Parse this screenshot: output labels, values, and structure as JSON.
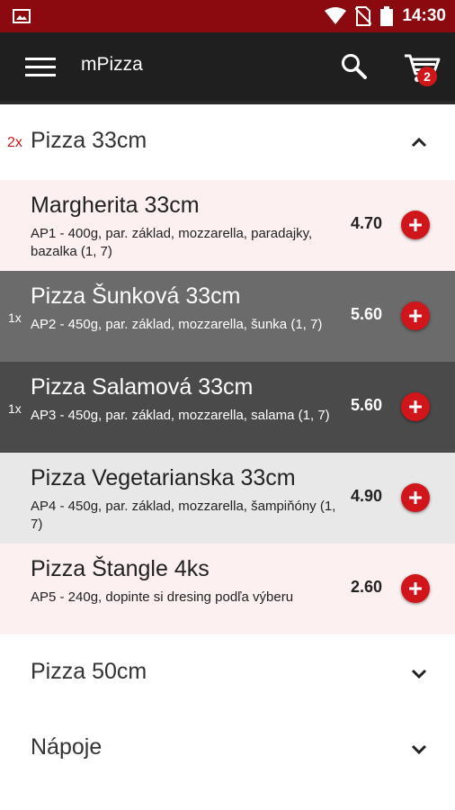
{
  "status_bar": {
    "time": "14:30",
    "icons": [
      "image-icon",
      "wifi-icon",
      "no-sim-icon",
      "battery-icon"
    ]
  },
  "app_bar": {
    "title": "mPizza",
    "cart_badge": "2",
    "icons": [
      "menu-icon",
      "search-icon",
      "cart-icon"
    ]
  },
  "colors": {
    "status_bar": "#8b0a0f",
    "app_bar": "#1f1f1f",
    "accent": "#d0161b"
  },
  "categories": [
    {
      "count": "2x",
      "name": "Pizza 33cm",
      "expanded": true,
      "items": [
        {
          "qty": "",
          "name": "Margherita 33cm",
          "desc": "AP1 - 400g, par. základ, mozzarella, paradajky, bazalka (1, 7)",
          "price": "4.70"
        },
        {
          "qty": "1x",
          "name": "Pizza Šunková 33cm",
          "desc": "AP2 - 450g, par. základ, mozzarella, šunka (1, 7)",
          "price": "5.60"
        },
        {
          "qty": "1x",
          "name": "Pizza Salamová 33cm",
          "desc": "AP3 - 450g, par. základ, mozzarella, salama (1, 7)",
          "price": "5.60"
        },
        {
          "qty": "",
          "name": "Pizza Vegetarianska 33cm",
          "desc": "AP4 - 450g, par. základ, mozzarella, šampiňóny (1, 7)",
          "price": "4.90"
        },
        {
          "qty": "",
          "name": "Pizza Štangle 4ks",
          "desc": "AP5 - 240g, dopinte si dresing podľa výberu",
          "price": "2.60"
        }
      ]
    },
    {
      "count": "",
      "name": "Pizza 50cm",
      "expanded": false
    },
    {
      "count": "",
      "name": "Nápoje",
      "expanded": false
    }
  ]
}
